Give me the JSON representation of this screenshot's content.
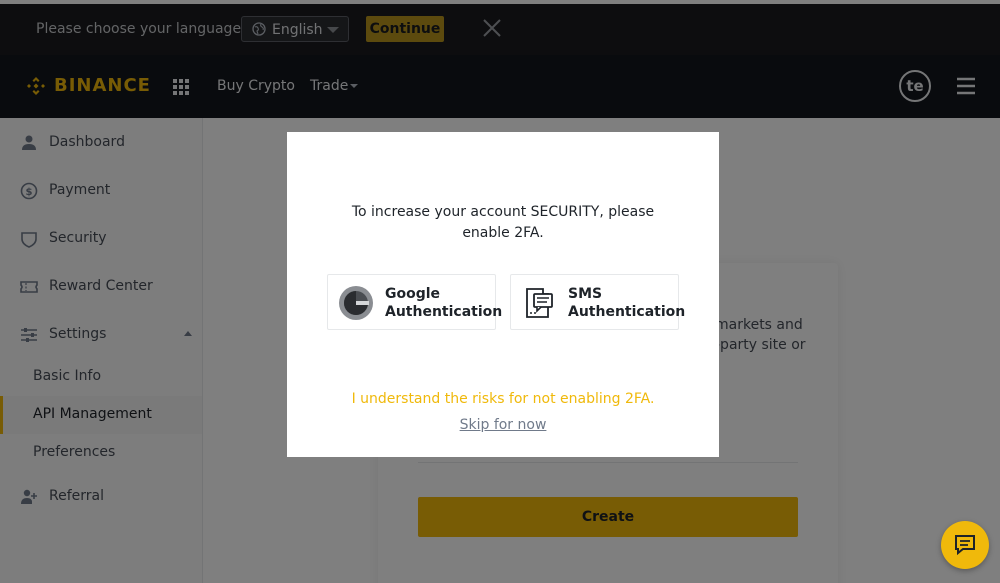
{
  "language_bar": {
    "message": "Please choose your language.",
    "selected_language": "English",
    "continue_label": "Continue"
  },
  "header": {
    "brand": "BINANCE",
    "nav": [
      {
        "label": "Buy Crypto"
      },
      {
        "label": "Trade"
      }
    ],
    "avatar_initials": "te"
  },
  "sidebar": {
    "items": [
      {
        "label": "Dashboard",
        "icon": "user-icon"
      },
      {
        "label": "Payment",
        "icon": "dollar-circle-icon"
      },
      {
        "label": "Security",
        "icon": "shield-icon"
      },
      {
        "label": "Reward Center",
        "icon": "ticket-icon"
      },
      {
        "label": "Settings",
        "icon": "sliders-icon"
      }
    ],
    "settings_sub": [
      {
        "label": "Basic Info"
      },
      {
        "label": "API Management"
      },
      {
        "label": "Preferences"
      }
    ],
    "referral": {
      "label": "Referral",
      "icon": "add-user-icon"
    }
  },
  "main": {
    "card_text": "markets and\n-party site or",
    "create_label": "Create"
  },
  "modal": {
    "headline": "To increase your account SECURITY, please enable 2FA.",
    "options": [
      {
        "label_line1": "Google",
        "label_line2": "Authentication",
        "icon": "google-authenticator-icon"
      },
      {
        "label_line1": "SMS",
        "label_line2": "Authentication",
        "icon": "sms-document-icon"
      }
    ],
    "risk_text": "I understand the risks for not enabling 2FA.",
    "skip_label": "Skip for now"
  },
  "colors": {
    "brand": "#f0b90b",
    "header_bg": "#12161c",
    "langbar_bg": "#1a1b1e"
  }
}
